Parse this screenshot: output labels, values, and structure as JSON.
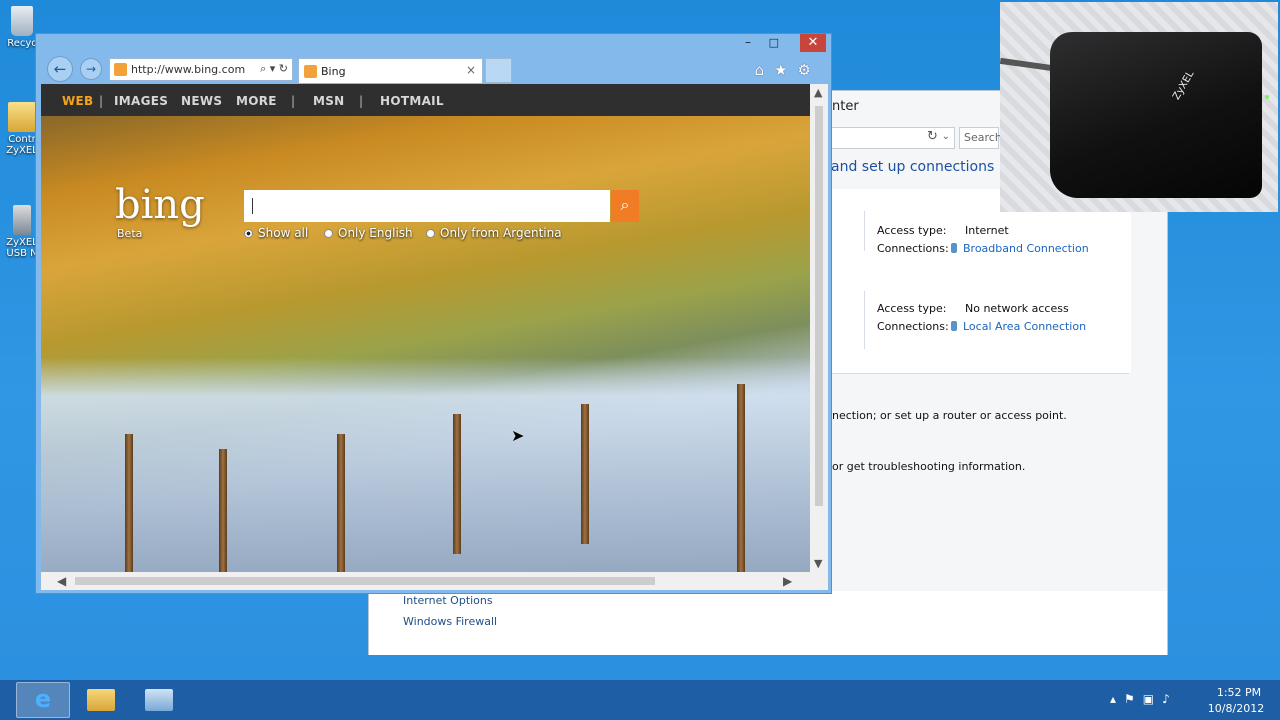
{
  "desktop": {
    "icons": [
      {
        "label": "Recyc",
        "icon": "recycle-bin-icon"
      },
      {
        "label": "Contr\nZyXEL",
        "icon": "folder-icon"
      },
      {
        "label": "ZyXEL\nUSB N",
        "icon": "usb-adapter-icon"
      }
    ]
  },
  "control_panel": {
    "title_fragment": "nter",
    "search_placeholder": "Search",
    "heading_fragment": "and set up connections",
    "networks": [
      {
        "access_type_label": "Access type:",
        "access_type": "Internet",
        "connections_label": "Connections:",
        "connection": "Broadband Connection"
      },
      {
        "access_type_label": "Access type:",
        "access_type": "No network access",
        "connections_label": "Connections:",
        "connection": "Local Area Connection"
      }
    ],
    "task_desc_1": "nection; or set up a router or access point.",
    "task_desc_2": "or get troubleshooting information.",
    "see_also": [
      "Internet Options",
      "Windows Firewall"
    ]
  },
  "browser": {
    "window_controls": {
      "minimize": "–",
      "maximize": "□",
      "close": "✕"
    },
    "address": "http://www.bing.com",
    "tab_title": "Bing",
    "tab_close": "×",
    "tool_icons": [
      "home-icon",
      "favorites-star-icon",
      "settings-gear-icon"
    ]
  },
  "bing": {
    "nav": {
      "web": "WEB",
      "images": "IMAGES",
      "news": "NEWS",
      "more": "MORE",
      "msn": "MSN",
      "hotmail": "HOTMAIL",
      "separator": "|"
    },
    "logo_text": "bing",
    "beta_label": "Beta",
    "search_value": "",
    "search_options": [
      {
        "label": "Show all",
        "selected": true
      },
      {
        "label": "Only English",
        "selected": false
      },
      {
        "label": "Only from Argentina",
        "selected": false
      }
    ],
    "accent_color": "#f3a31d"
  },
  "webcam": {
    "router_brand": "ZyXEL"
  },
  "taskbar": {
    "pinned": [
      "internet-explorer-icon",
      "file-explorer-icon",
      "control-panel-icon"
    ],
    "time": "1:52 PM",
    "date": "10/8/2012"
  }
}
